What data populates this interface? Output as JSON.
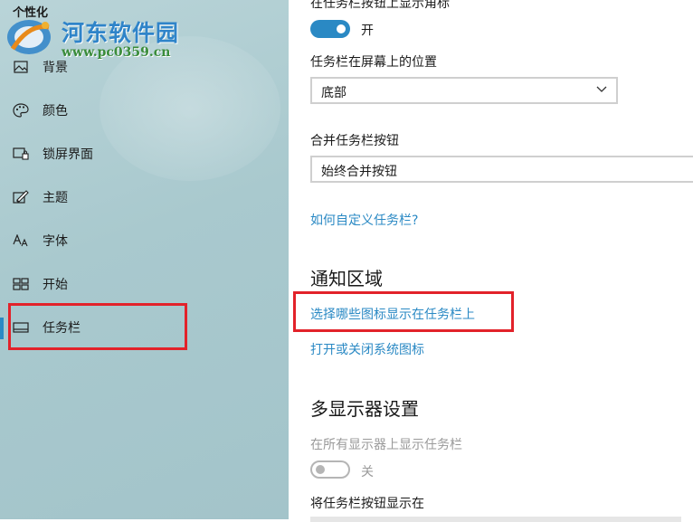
{
  "sidebar": {
    "title": "个性化",
    "watermark": {
      "name": "河东软件园",
      "url": "www.pc0359.cn"
    },
    "items": [
      {
        "label": "背景",
        "icon": "picture-icon"
      },
      {
        "label": "颜色",
        "icon": "palette-icon"
      },
      {
        "label": "锁屏界面",
        "icon": "lock-screen-icon"
      },
      {
        "label": "主题",
        "icon": "theme-brush-icon"
      },
      {
        "label": "字体",
        "icon": "font-icon"
      },
      {
        "label": "开始",
        "icon": "start-grid-icon"
      },
      {
        "label": "任务栏",
        "icon": "taskbar-icon"
      }
    ],
    "selected": "任务栏"
  },
  "main": {
    "top_cut_label": "在任务栏按钮上显示角标",
    "badge_toggle": {
      "state": "开",
      "on": true
    },
    "position": {
      "label": "任务栏在屏幕上的位置",
      "value": "底部"
    },
    "combine": {
      "label": "合并任务栏按钮",
      "value": "始终合并按钮"
    },
    "customize_link": "如何自定义任务栏?",
    "notification": {
      "title": "通知区域",
      "link_select_icons": "选择哪些图标显示在任务栏上",
      "link_system_icons": "打开或关闭系统图标"
    },
    "multi_display": {
      "title": "多显示器设置",
      "show_all_label": "在所有显示器上显示任务栏",
      "show_all_toggle": {
        "state": "关",
        "on": false
      },
      "buttons_on_label": "将任务栏按钮显示在"
    }
  },
  "colors": {
    "accent": "#2a89c4",
    "highlight": "#e2222a"
  }
}
